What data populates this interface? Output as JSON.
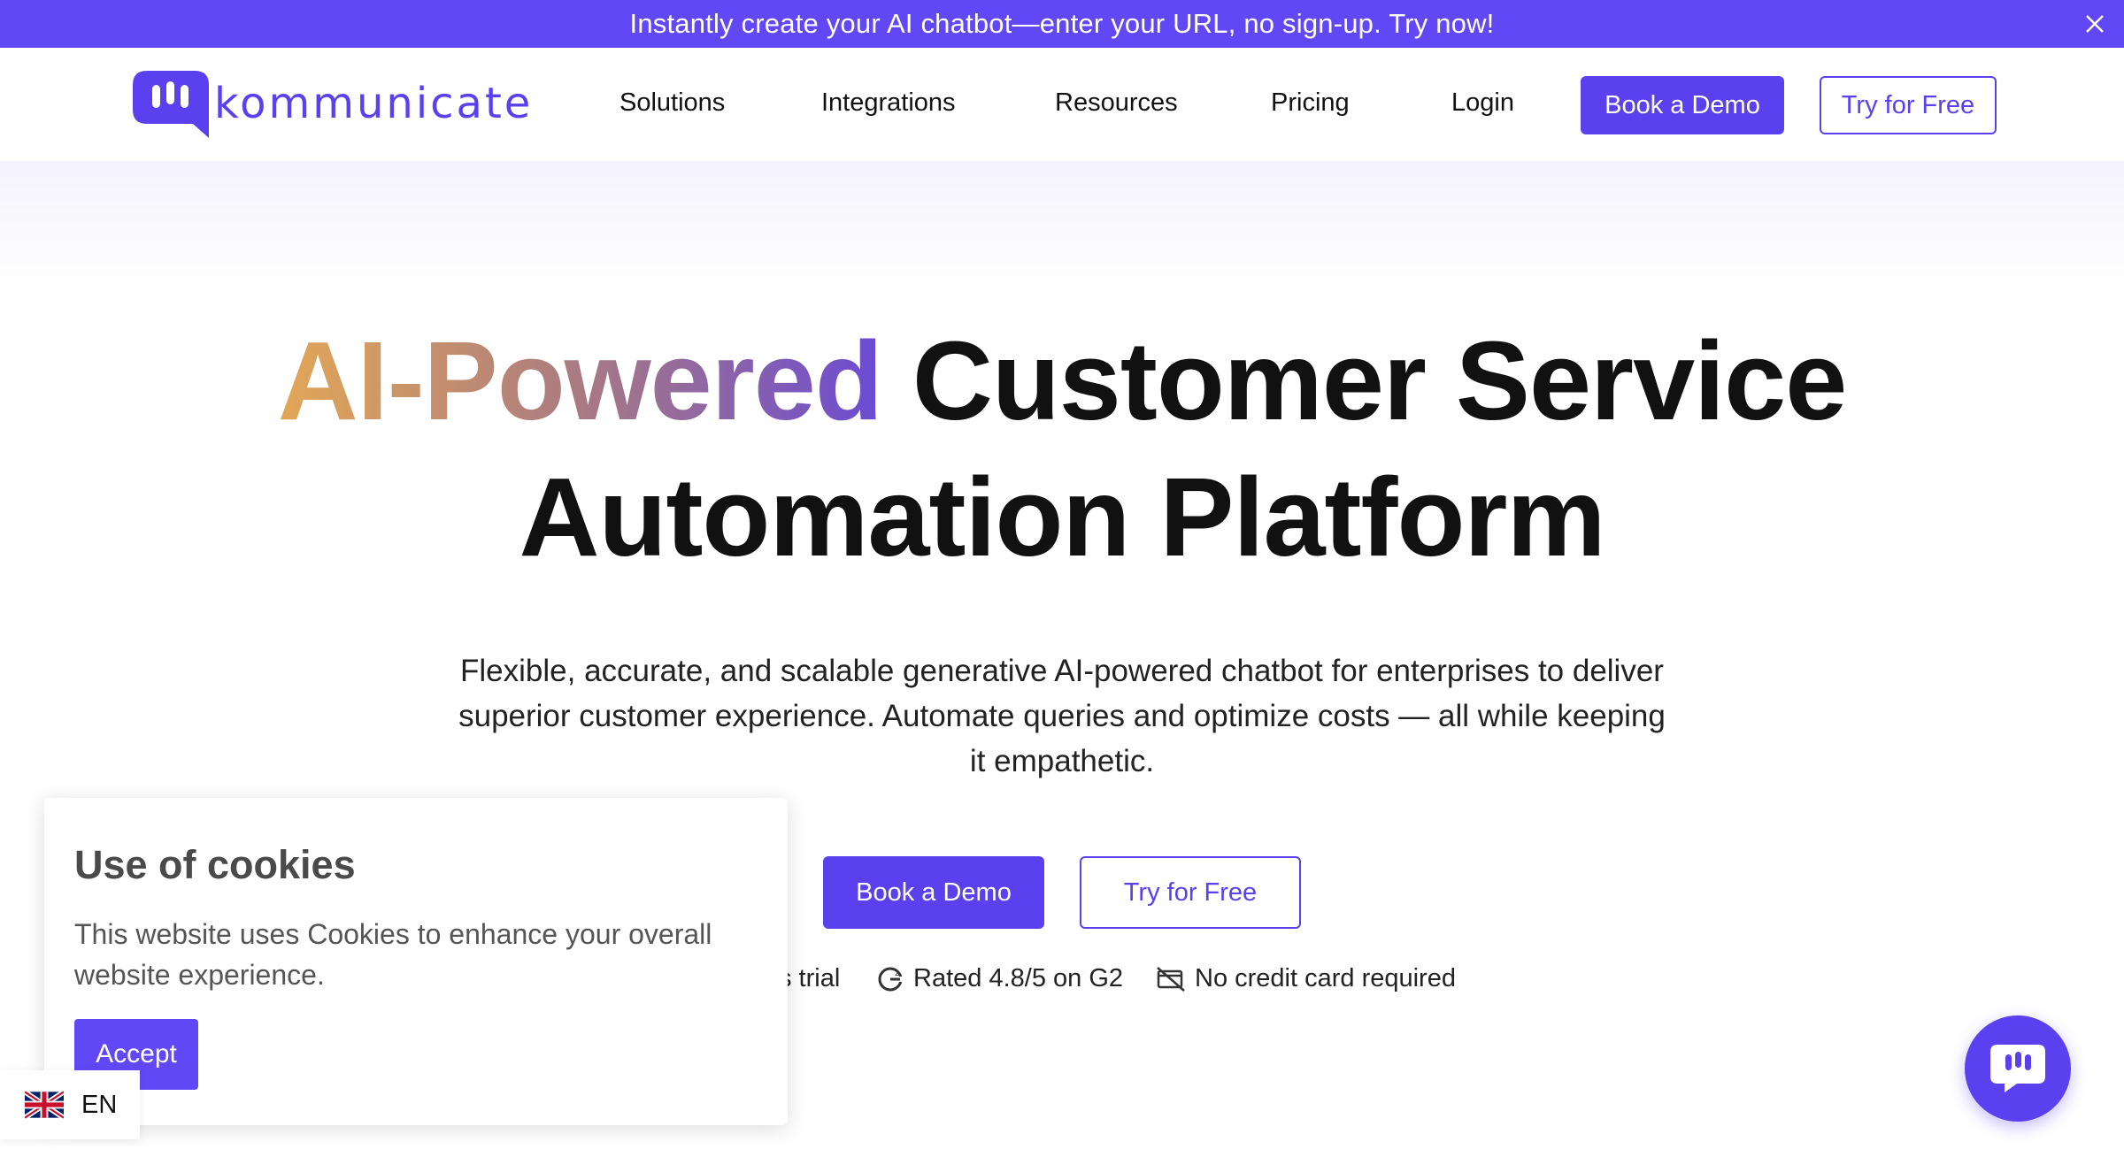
{
  "announcement": {
    "text": "Instantly create your AI chatbot—enter your URL, no sign-up. Try now!",
    "close_icon": "close-icon"
  },
  "brand": {
    "name": "kommunicate",
    "logo_icon": "chat-bubble-logo-icon",
    "accent_color": "#5b40f0"
  },
  "nav": {
    "items": [
      "Solutions",
      "Integrations",
      "Resources",
      "Pricing",
      "Login"
    ],
    "book_demo_label": "Book a Demo",
    "try_free_label": "Try for Free"
  },
  "hero": {
    "title_highlight": "AI-Powered",
    "title_rest": " Customer Service",
    "title_line2": "Automation Platform",
    "subtitle": "Flexible, accurate, and scalable generative AI-powered chatbot for enterprises to deliver superior customer experience. Automate queries and optimize costs — all while keeping it empathetic.",
    "cta_primary": "Book a Demo",
    "cta_secondary": "Try for Free"
  },
  "trust": {
    "trial_fragment": "s trial",
    "rating_text": "Rated 4.8/5 on G2",
    "rating_icon": "g2-icon",
    "no_card_text": "No credit card required",
    "no_card_icon": "no-credit-card-icon"
  },
  "cookie": {
    "title": "Use of cookies",
    "text": "This website uses Cookies to enhance your overall website experience.",
    "accept_label": "Accept"
  },
  "language": {
    "code": "EN",
    "flag_icon": "uk-flag-icon"
  },
  "chat_widget": {
    "icon": "chat-launcher-icon"
  }
}
